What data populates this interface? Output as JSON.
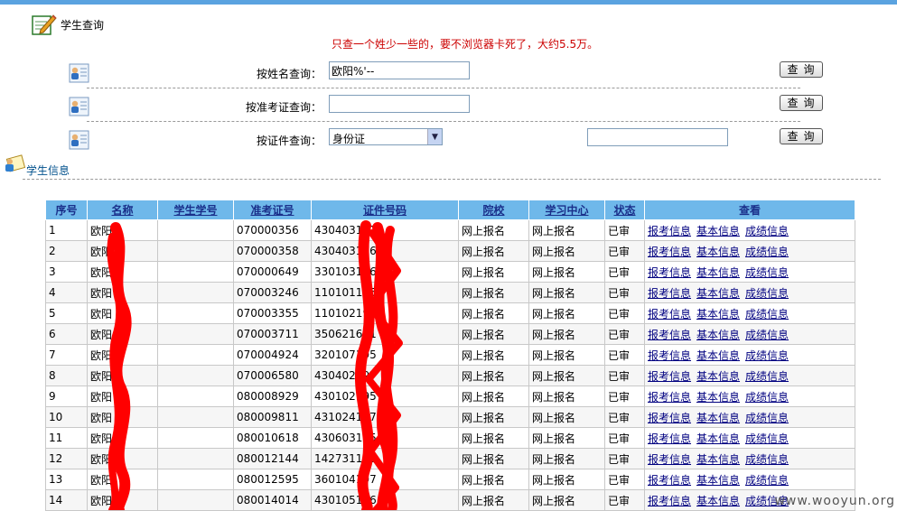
{
  "page": {
    "title": "学生查询",
    "notice": "只查一个姓少一些的，要不浏览器卡死了，大约5.5万。"
  },
  "search": {
    "name_label": "按姓名查询：",
    "name_value": "欧阳%'--",
    "exam_label": "按准考证查询：",
    "exam_value": "",
    "id_label": "按证件查询：",
    "id_type": "身份证",
    "id_value": "",
    "button_label": "查询"
  },
  "section": {
    "title": "学生信息"
  },
  "table": {
    "columns": [
      "序号",
      "名称",
      "学生学号",
      "准考证号",
      "证件号码",
      "院校",
      "学习中心",
      "状态",
      "查看"
    ],
    "links": [
      "报考信息",
      "基本信息",
      "成绩信息"
    ],
    "rows": [
      [
        "1",
        "欧阳",
        "",
        "070000356",
        "4304031970",
        "网上报名",
        "网上报名",
        "已审"
      ],
      [
        "2",
        "欧阳",
        "",
        "070000358",
        "430403196",
        "网上报名",
        "网上报名",
        "已审"
      ],
      [
        "3",
        "欧阳",
        "",
        "070000649",
        "330103196",
        "网上报名",
        "网上报名",
        "已审"
      ],
      [
        "4",
        "欧阳",
        "",
        "070003246",
        "110101195",
        "网上报名",
        "网上报名",
        "已审"
      ],
      [
        "5",
        "欧阳",
        "",
        "070003355",
        "110102197",
        "网上报名",
        "网上报名",
        "已审"
      ],
      [
        "6",
        "欧阳",
        "",
        "070003711",
        "350621651",
        "网上报名",
        "网上报名",
        "已审"
      ],
      [
        "7",
        "欧阳",
        "",
        "070004924",
        "320107195",
        "网上报名",
        "网上报名",
        "已审"
      ],
      [
        "8",
        "欧阳",
        "",
        "070006580",
        "430402197",
        "网上报名",
        "网上报名",
        "已审"
      ],
      [
        "9",
        "欧阳",
        "",
        "080008929",
        "430102195",
        "网上报名",
        "网上报名",
        "已审"
      ],
      [
        "10",
        "欧阳",
        "",
        "080009811",
        "431024197",
        "网上报名",
        "网上报名",
        "已审"
      ],
      [
        "11",
        "欧阳",
        "",
        "080010618",
        "430603195",
        "网上报名",
        "网上报名",
        "已审"
      ],
      [
        "12",
        "欧阳",
        "",
        "080012144",
        "142731196",
        "网上报名",
        "网上报名",
        "已审"
      ],
      [
        "13",
        "欧阳",
        "",
        "080012595",
        "360104197",
        "网上报名",
        "网上报名",
        "已审"
      ],
      [
        "14",
        "欧阳",
        "",
        "080014014",
        "430105196",
        "网上报名",
        "网上报名",
        "已审"
      ]
    ]
  },
  "watermark": "www.wooyun.org",
  "colors": {
    "top_bar": "#5aa3e0",
    "notice": "#cc0000",
    "header_bg": "#6fb8ea",
    "header_text": "#1a2f8a",
    "redaction": "#ff0000"
  }
}
